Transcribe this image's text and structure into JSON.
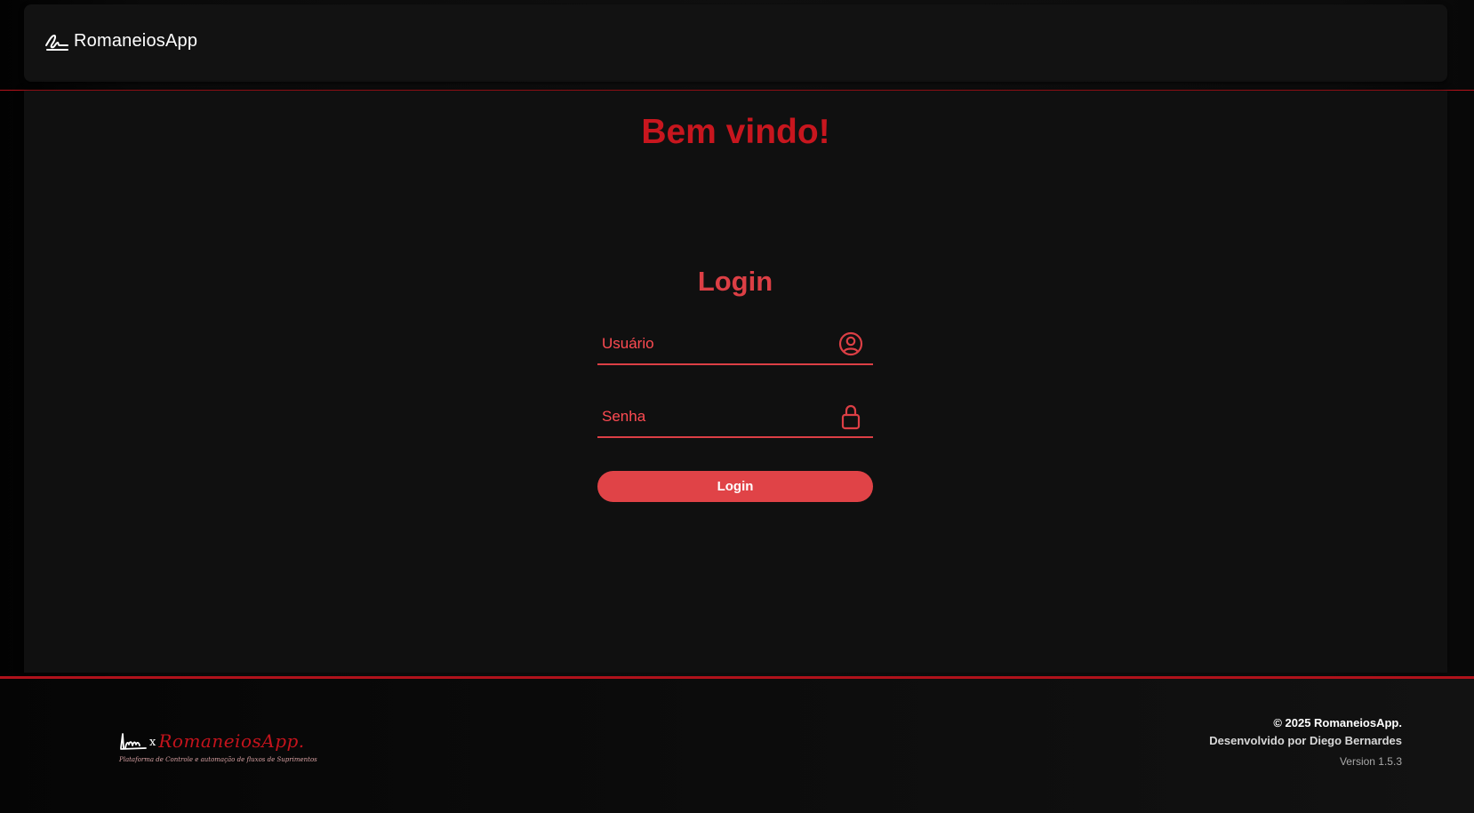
{
  "navbar": {
    "brand_name": "RomaneiosApp",
    "brand_icon": "signature-icon"
  },
  "main": {
    "welcome_title": "Bem vindo!",
    "login": {
      "title": "Login",
      "username_placeholder": "Usuário",
      "username_value": "",
      "username_icon": "user-circle-icon",
      "password_placeholder": "Senha",
      "password_value": "",
      "password_icon": "lock-icon",
      "submit_label": "Login"
    }
  },
  "footer": {
    "logo": {
      "separator": "x",
      "name": "RomaneiosApp.",
      "tagline": "Plataforma de Controle e automação de fluxos de Suprimentos"
    },
    "copyright": "© 2025 RomaneiosApp.",
    "developer": "Desenvolvido por Diego Bernardes",
    "version": "Version 1.5.3"
  },
  "colors": {
    "accent_red": "#dc3f45",
    "dark_red": "#c8161e",
    "button_red": "#e04347",
    "background": "#101010"
  }
}
